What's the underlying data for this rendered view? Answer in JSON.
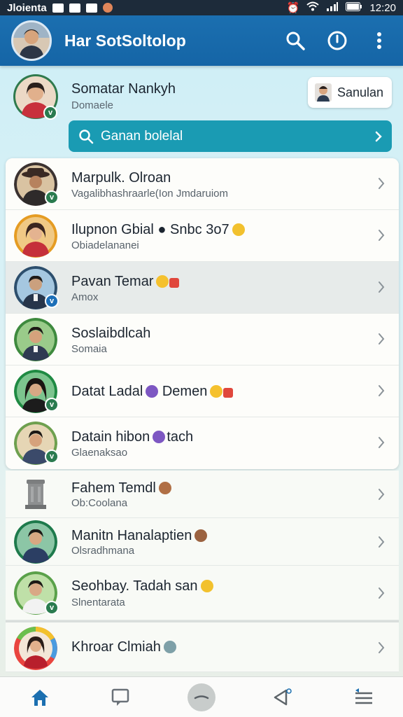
{
  "status_bar": {
    "carrier": "Jloienta",
    "time": "12:20"
  },
  "app_bar": {
    "title": "Har SotSoltolop"
  },
  "profile": {
    "name": "Somatar Nankyh",
    "subtitle": "Domaele",
    "chip_label": "Sanulan"
  },
  "search": {
    "label": "Ganan bolelal"
  },
  "contacts": [
    {
      "name": "Marpulk. Olroan",
      "status": "Vagalibhashraarle(Ion Jmdaruiom",
      "emoji": "",
      "emoji_color": "",
      "avatar_bg": "#3b3231",
      "shirt": "#2e2a2a",
      "badge": "v",
      "badge_color": "green",
      "highlight": false
    },
    {
      "name": "Ilupnon Gbial ● Snbc 3o7",
      "status": "Obiadelananei",
      "emoji": "smile",
      "emoji_color": "#f2a21e",
      "avatar_bg": "#e59c23",
      "shirt": "#c5303a",
      "badge": "",
      "badge_color": "",
      "highlight": false
    },
    {
      "name": "Pavan Temar",
      "status": "Amox",
      "emoji": "smile-star",
      "emoji_color": "#f5c12e",
      "avatar_bg": "#7aa7cc",
      "shirt": "#27354a",
      "badge": "v",
      "badge_color": "blue",
      "highlight": true
    },
    {
      "name": "Soslaibdlcah",
      "status": "Somaia",
      "emoji": "",
      "emoji_color": "",
      "avatar_bg": "#3e8a3e",
      "shirt": "#2f3a52",
      "badge": "",
      "badge_color": "",
      "highlight": false
    },
    {
      "name": "Datat Ladal",
      "status": "",
      "emoji": "purple",
      "emoji_color": "#7d57c2",
      "avatar_bg": "#1f8a43",
      "shirt": "#1c1c1c",
      "badge": "v",
      "badge_color": "green",
      "highlight": false,
      "tail": "Demen"
    },
    {
      "name": "Datain hibon",
      "status": "Glaenaksao",
      "emoji": "purple",
      "emoji_color": "#7d57c2",
      "avatar_bg": "#8fbb6e",
      "shirt": "#3b4a6a",
      "badge": "v",
      "badge_color": "green",
      "highlight": false,
      "tail": "tach"
    }
  ],
  "more_contacts": [
    {
      "name": "Fahem Temdl",
      "status": "Ob:Coolana",
      "emoji_color": "#b06f45",
      "avatar_bg": "#f4f4f2",
      "shirt": "#6a6a6a",
      "badge": ""
    },
    {
      "name": "Manitn Hanalaptien",
      "status": "Olsradhmana",
      "emoji_color": "#9b6240",
      "avatar_bg": "#1e7a4c",
      "shirt": "#2b3e63",
      "badge": ""
    },
    {
      "name": "Seohbay. Tadah san",
      "status": "Slnentarata",
      "emoji_color": "#f2c12d",
      "avatar_bg": "#5aa14a",
      "shirt": "#f2f2f2",
      "badge": "v"
    },
    {
      "name": "Khroar Clmiah",
      "status": "",
      "emoji_color": "#7ea0a8",
      "avatar_bg": "#e9453f",
      "shirt": "#b81f2c",
      "badge": ""
    }
  ],
  "colors": {
    "appbar": "#1b6fb0",
    "accent": "#1a9bb3",
    "badge_green": "#2a7b4f"
  }
}
